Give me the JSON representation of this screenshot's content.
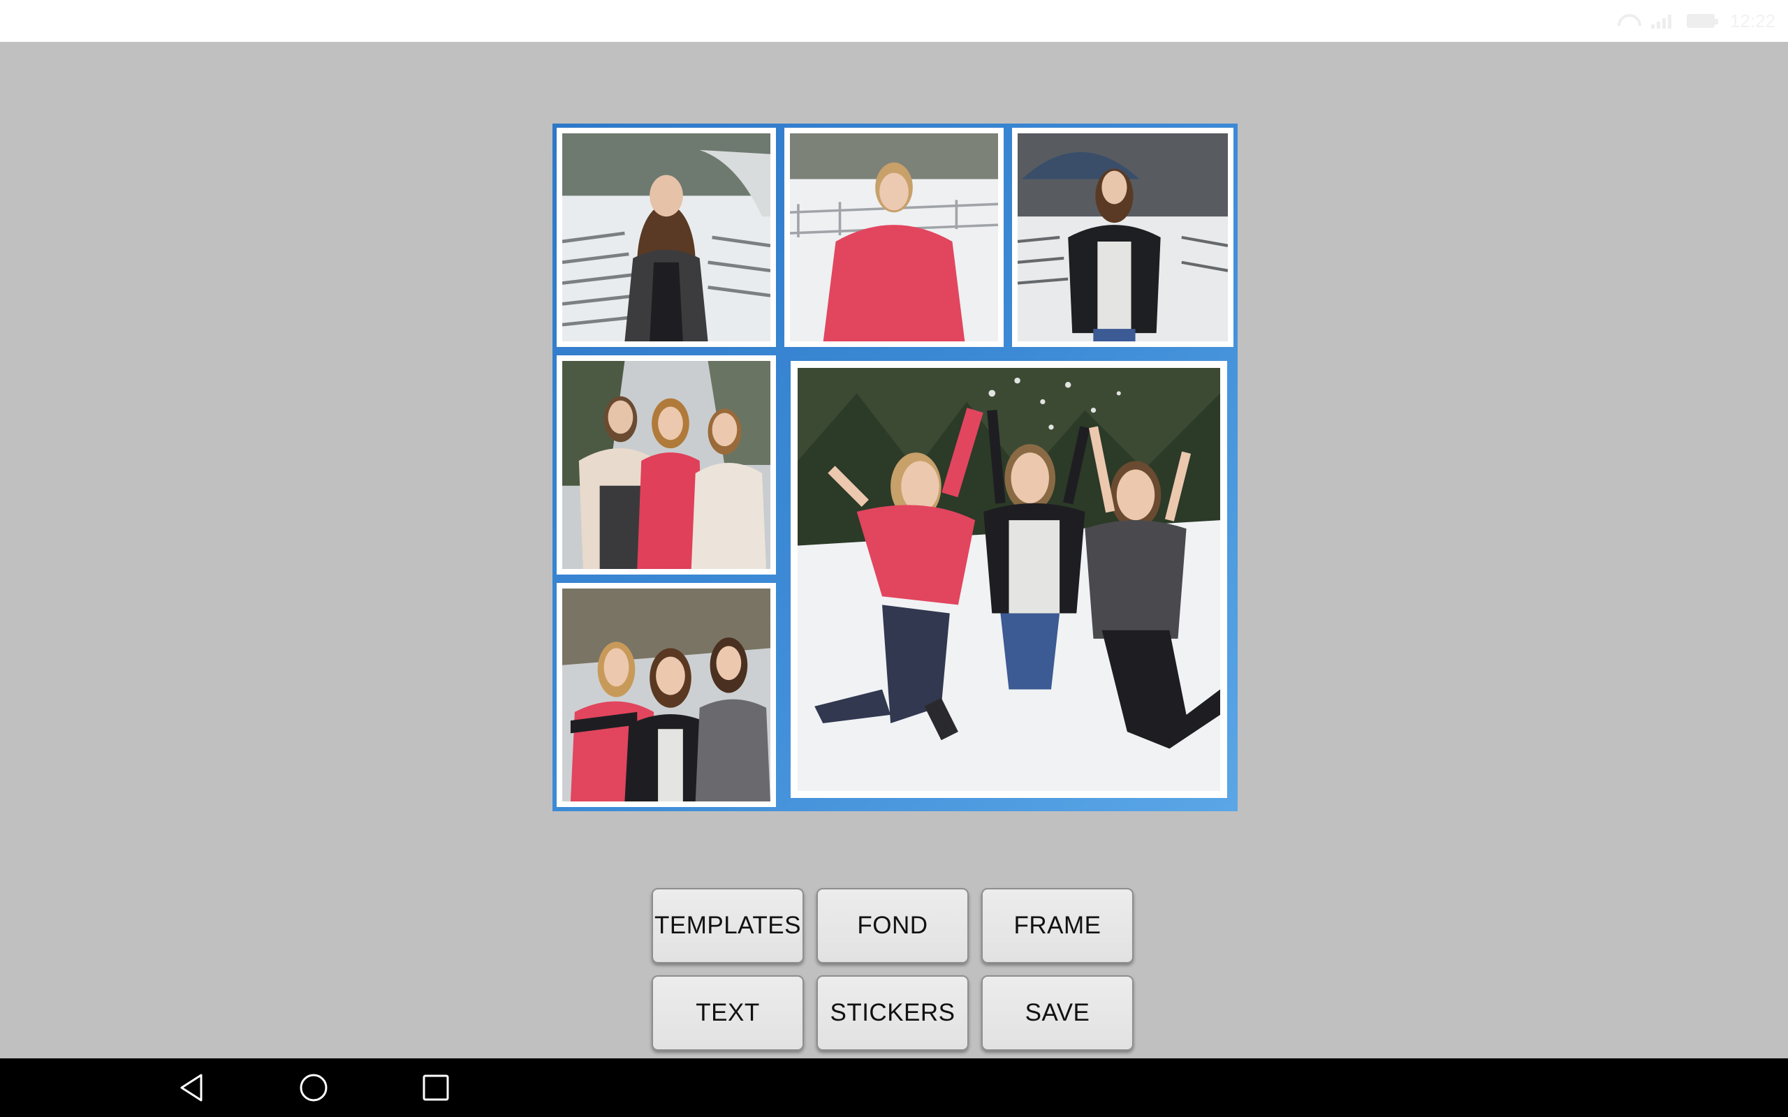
{
  "status_bar": {
    "time": "12:22",
    "colors": {
      "background": "#ffffff",
      "icon": "#eeeeee"
    }
  },
  "collage": {
    "frame_color": "#3c8ad6",
    "cells": [
      {
        "id": "photo-1",
        "subject": "girl in grey cardigan, snowy benches"
      },
      {
        "id": "photo-2",
        "subject": "girl in pink sweater, snow"
      },
      {
        "id": "photo-3",
        "subject": "girl in black jacket, snowy amphitheater"
      },
      {
        "id": "photo-4",
        "subject": "three girls with shawls"
      },
      {
        "id": "photo-5",
        "subject": "three girls taking selfie"
      },
      {
        "id": "photo-6",
        "subject": "three girls jumping in snow"
      }
    ]
  },
  "toolbar": {
    "templates_label": "TEMPLATES",
    "fond_label": "FOND",
    "frame_label": "FRAME",
    "text_label": "TEXT",
    "stickers_label": "STICKERS",
    "save_label": "SAVE"
  },
  "nav_bar": {
    "icons": [
      "back-icon",
      "home-icon",
      "recents-icon"
    ],
    "color": "#000000"
  }
}
